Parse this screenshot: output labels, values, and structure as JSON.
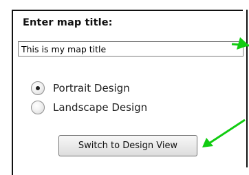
{
  "form": {
    "title_label": "Enter map title:",
    "title_value": "This is my map title",
    "orientation": {
      "options": [
        {
          "label": "Portrait Design",
          "selected": true
        },
        {
          "label": "Landscape Design",
          "selected": false
        }
      ]
    },
    "switch_button_label": "Switch to Design View"
  },
  "annotations": {
    "arrow_color": "#11cc11"
  }
}
